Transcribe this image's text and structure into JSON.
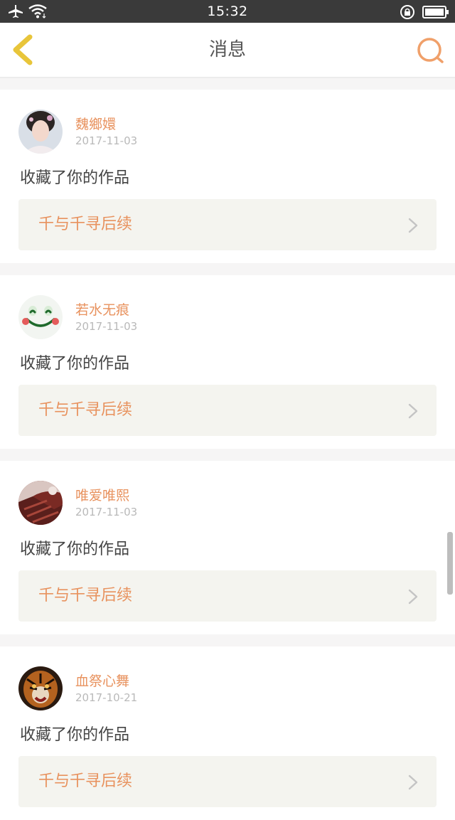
{
  "status_bar": {
    "time": "15:32",
    "icons": [
      "airplane-mode-icon",
      "wifi-icon",
      "rotation-lock-icon",
      "battery-icon"
    ]
  },
  "nav": {
    "title": "消息",
    "back_icon": "chevron-left-icon",
    "search_icon": "search-icon"
  },
  "colors": {
    "accent": "#e8925e",
    "back_icon": "#e8c53a",
    "status_bar": "#3a3a3a",
    "card_box": "#f4f4ef"
  },
  "messages": [
    {
      "username": "魏鄉嬛",
      "date": "2017-11-03",
      "action": "收藏了你的作品",
      "work_title": "千与千寻后续"
    },
    {
      "username": "若水无痕",
      "date": "2017-11-03",
      "action": "收藏了你的作品",
      "work_title": "千与千寻后续"
    },
    {
      "username": "唯爱唯熙",
      "date": "2017-11-03",
      "action": "收藏了你的作品",
      "work_title": "千与千寻后续"
    },
    {
      "username": "血祭心舞",
      "date": "2017-10-21",
      "action": "收藏了你的作品",
      "work_title": "千与千寻后续"
    }
  ]
}
